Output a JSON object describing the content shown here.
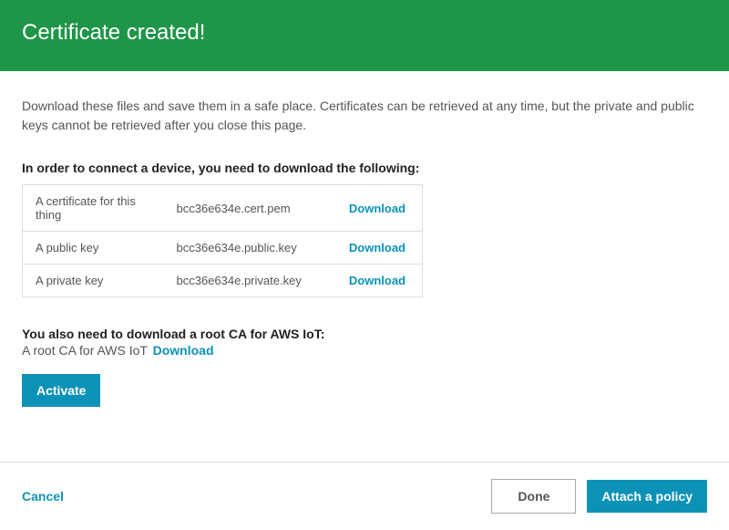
{
  "header": {
    "title": "Certificate created!"
  },
  "intro": "Download these files and save them in a safe place. Certificates can be retrieved at any time, but the private and public keys cannot be retrieved after you close this page.",
  "downloads": {
    "heading": "In order to connect a device, you need to download the following:",
    "link_label": "Download",
    "items": [
      {
        "label": "A certificate for this thing",
        "filename": "bcc36e634e.cert.pem"
      },
      {
        "label": "A public key",
        "filename": "bcc36e634e.public.key"
      },
      {
        "label": "A private key",
        "filename": "bcc36e634e.private.key"
      }
    ]
  },
  "root_ca": {
    "heading": "You also need to download a root CA for AWS IoT:",
    "label": "A root CA for AWS IoT",
    "link_label": "Download"
  },
  "buttons": {
    "activate": "Activate",
    "cancel": "Cancel",
    "done": "Done",
    "attach_policy": "Attach a policy"
  }
}
